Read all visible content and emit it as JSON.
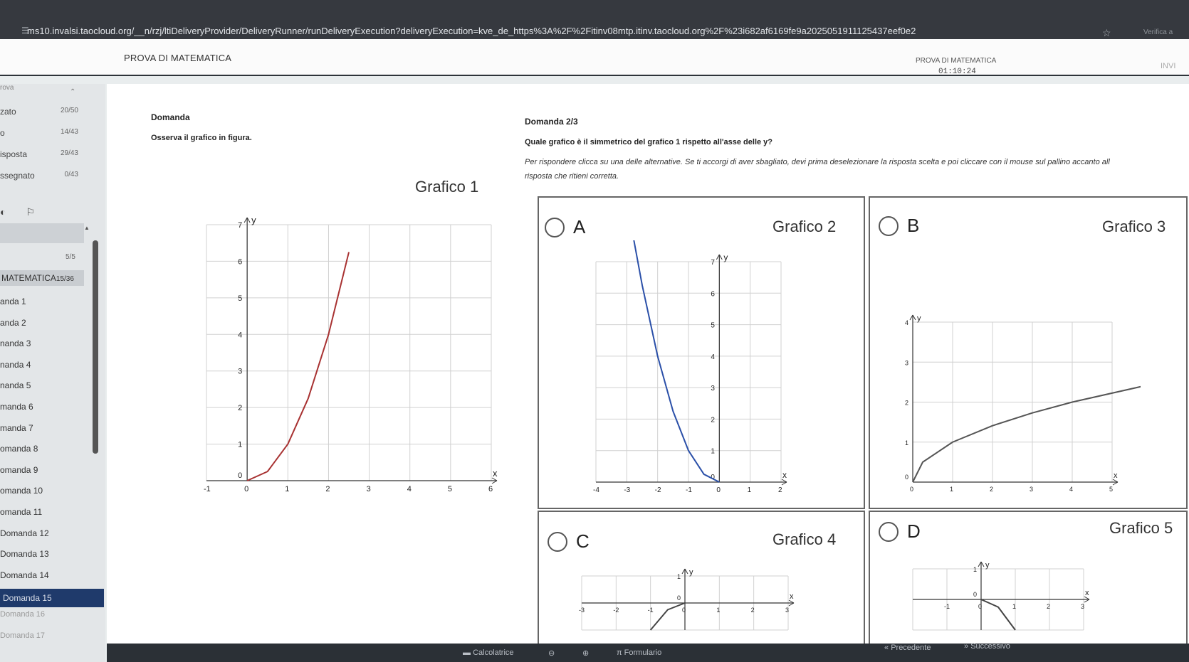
{
  "browser": {
    "url": "ms10.invalsi.taocloud.org/__n/rzj/ltiDeliveryProvider/DeliveryRunner/runDeliveryExecution?deliveryExecution=kve_de_https%3A%2F%2Fitinv08mtp.itinv.taocloud.org%2F%23i682af6169fe9a2025051911125437eef0e2",
    "extension_label": "Verifica a"
  },
  "header": {
    "title": "PROVA DI MATEMATICA",
    "right_title": "PROVA DI MATEMATICA",
    "timer": "01:10:24",
    "send_label": "INVI"
  },
  "sidebar": {
    "head": "rova",
    "stats": [
      {
        "label": "zato",
        "value": "20/50"
      },
      {
        "label": "o",
        "value": "14/43"
      },
      {
        "label": "isposta",
        "value": "29/43"
      },
      {
        "label": "ssegnato",
        "value": "0/43"
      }
    ],
    "section_count": "5/5",
    "section_label": "MATEMATICA",
    "section_value": "15/36",
    "items": [
      {
        "label": "anda 1"
      },
      {
        "label": "anda 2"
      },
      {
        "label": "nanda 3"
      },
      {
        "label": "nanda 4"
      },
      {
        "label": "nanda 5"
      },
      {
        "label": "manda 6"
      },
      {
        "label": "manda 7"
      },
      {
        "label": "omanda 8"
      },
      {
        "label": "omanda 9"
      },
      {
        "label": "omanda 10"
      },
      {
        "label": "omanda 11"
      },
      {
        "label": "Domanda 12"
      },
      {
        "label": "Domanda 13"
      },
      {
        "label": "Domanda 14"
      },
      {
        "label": "Domanda 15"
      },
      {
        "label": "Domanda 16"
      },
      {
        "label": "Domanda 17"
      }
    ]
  },
  "question": {
    "left_label": "Domanda",
    "stimulus": "Osserva il grafico in figura.",
    "graph_title": "Grafico 1",
    "subquestion_label": "Domanda 2/3",
    "prompt": "Quale grafico è il simmetrico del grafico 1 rispetto all'asse delle y?",
    "instruction_line1": "Per rispondere clicca su una delle alternative. Se ti accorgi di aver sbagliato, devi prima deselezionare la risposta scelta e poi cliccare con il mouse sul pallino accanto all",
    "instruction_line2": "risposta che ritieni corretta.",
    "options": [
      {
        "letter": "A",
        "graph": "Grafico 2"
      },
      {
        "letter": "B",
        "graph": "Grafico 3"
      },
      {
        "letter": "C",
        "graph": "Grafico 4"
      },
      {
        "letter": "D",
        "graph": "Grafico 5"
      }
    ]
  },
  "chart_data": [
    {
      "type": "line",
      "title": "Grafico 1",
      "xlabel": "x",
      "ylabel": "y",
      "xlim": [
        -1,
        6
      ],
      "ylim": [
        0,
        7
      ],
      "x_ticks": [
        "-1",
        "0",
        "1",
        "2",
        "3",
        "4",
        "5",
        "6"
      ],
      "y_ticks": [
        "0",
        "1",
        "2",
        "3",
        "4",
        "5",
        "6",
        "7"
      ],
      "series": [
        {
          "x": [
            0,
            0.5,
            1,
            1.5,
            2,
            2.5
          ],
          "y": [
            0,
            0.25,
            1,
            2.25,
            4,
            6.25
          ],
          "color": "#a83232"
        }
      ],
      "grid": true
    },
    {
      "type": "line",
      "title": "Grafico 2",
      "xlabel": "x",
      "ylabel": "y",
      "xlim": [
        -4,
        2
      ],
      "ylim": [
        0,
        7
      ],
      "x_ticks": [
        "-4",
        "-3",
        "-2",
        "-1",
        "0",
        "1",
        "2"
      ],
      "y_ticks": [
        "0",
        "1",
        "2",
        "3",
        "4",
        "5",
        "6",
        "7"
      ],
      "series": [
        {
          "x": [
            -2.8,
            -2.5,
            -2,
            -1.5,
            -1,
            -0.5,
            0
          ],
          "y": [
            7.84,
            6.25,
            4,
            2.25,
            1,
            0.25,
            0
          ],
          "color": "#2a4fa8"
        }
      ],
      "grid": true
    },
    {
      "type": "line",
      "title": "Grafico 3",
      "xlabel": "x",
      "ylabel": "y",
      "xlim": [
        0,
        5
      ],
      "ylim": [
        0,
        4
      ],
      "x_ticks": [
        "0",
        "1",
        "2",
        "3",
        "4",
        "5"
      ],
      "y_ticks": [
        "0",
        "1",
        "2",
        "3",
        "4"
      ],
      "series": [
        {
          "x": [
            0,
            0.25,
            1,
            2,
            3,
            4,
            6
          ],
          "y": [
            0,
            0.5,
            1,
            1.41,
            1.73,
            2,
            2.45
          ],
          "color": "#555555"
        }
      ],
      "grid": true
    },
    {
      "type": "line",
      "title": "Grafico 4",
      "xlabel": "x",
      "ylabel": "y",
      "xlim": [
        -3,
        3
      ],
      "ylim": [
        -1,
        1
      ],
      "x_ticks": [
        "-3",
        "-2",
        "-1",
        "0",
        "1",
        "2",
        "3"
      ],
      "y_ticks": [
        "0",
        "1"
      ],
      "series": [
        {
          "x": [
            -1,
            -0.5,
            0
          ],
          "y": [
            -1,
            -0.25,
            0
          ],
          "color": "#444444"
        }
      ],
      "grid": true
    },
    {
      "type": "line",
      "title": "Grafico 5",
      "xlabel": "x",
      "ylabel": "y",
      "xlim": [
        -2,
        3
      ],
      "ylim": [
        -1,
        1
      ],
      "x_ticks": [
        "-1",
        "0",
        "1",
        "2",
        "3"
      ],
      "y_ticks": [
        "0",
        "1"
      ],
      "series": [
        {
          "x": [
            0,
            0.5,
            1
          ],
          "y": [
            0,
            -0.25,
            -1
          ],
          "color": "#444444"
        }
      ],
      "grid": true
    }
  ],
  "bottombar": {
    "calculator": "Calcolatrice",
    "formulary": "Formulario",
    "previous": "Precedente",
    "next": "Successivo"
  }
}
